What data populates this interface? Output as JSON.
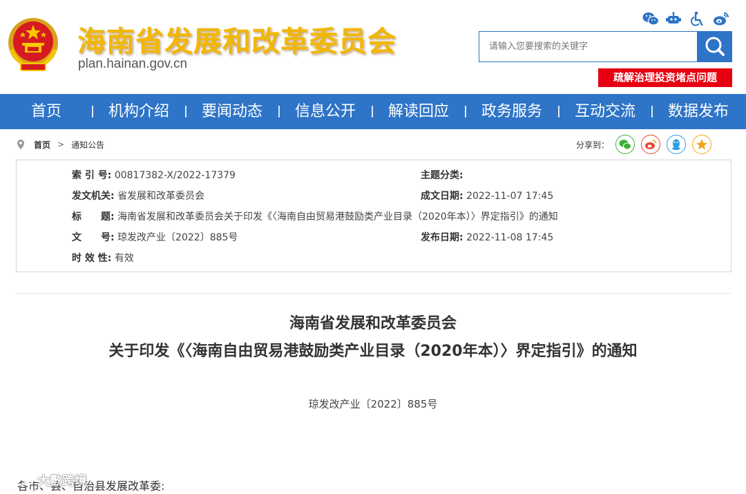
{
  "header": {
    "site_title": "海南省发展和改革委员会",
    "site_url": "plan.hainan.gov.cn",
    "search_placeholder": "请输入您要搜索的关键字",
    "banner": "疏解治理投资堵点问题",
    "icons": [
      "wechat-icon",
      "robot-icon",
      "accessibility-icon",
      "weibo-icon"
    ]
  },
  "nav": {
    "items": [
      {
        "label": "首页"
      },
      {
        "label": "机构介绍"
      },
      {
        "label": "要闻动态"
      },
      {
        "label": "信息公开"
      },
      {
        "label": "解读回应"
      },
      {
        "label": "政务服务"
      },
      {
        "label": "互动交流"
      },
      {
        "label": "数据发布"
      }
    ]
  },
  "breadcrumb": {
    "home": "首页",
    "separator": ">",
    "current": "通知公告"
  },
  "share": {
    "label": "分享到：",
    "targets": [
      "wechat-icon",
      "weibo-icon",
      "qq-icon",
      "qzone-star-icon"
    ]
  },
  "meta": {
    "index_label": "索 引 号:",
    "index_value": "00817382-X/2022-17379",
    "topic_label": "主题分类:",
    "topic_value": "",
    "issuer_label": "发文机关:",
    "issuer_value": "省发展和改革委员会",
    "date_written_label": "成文日期:",
    "date_written_value": "2022-11-07 17:45",
    "title_label": "标　　题:",
    "title_value": "海南省发展和改革委员会关于印发《〈海南自由贸易港鼓励类产业目录（2020年本）〉界定指引》的通知",
    "doc_no_label": "文　　号:",
    "doc_no_value": "琼发改产业〔2022〕885号",
    "publish_label": "发布日期:",
    "publish_value": "2022-11-08 17:45",
    "validity_label": "时 效 性:",
    "validity_value": "有效"
  },
  "document": {
    "title_line1": "海南省发展和改革委员会",
    "title_line2": "关于印发《〈海南自由贸易港鼓励类产业目录（2020年本）〉界定指引》的通知",
    "number": "琼发改产业〔2022〕885号",
    "greeting": "各市、县、自治县发展改革委:"
  },
  "watermark": {
    "text": "大數跨境"
  },
  "colors": {
    "nav_blue": "#2e74c7",
    "title_gold": "#f2b705",
    "banner_red": "#e60012"
  }
}
